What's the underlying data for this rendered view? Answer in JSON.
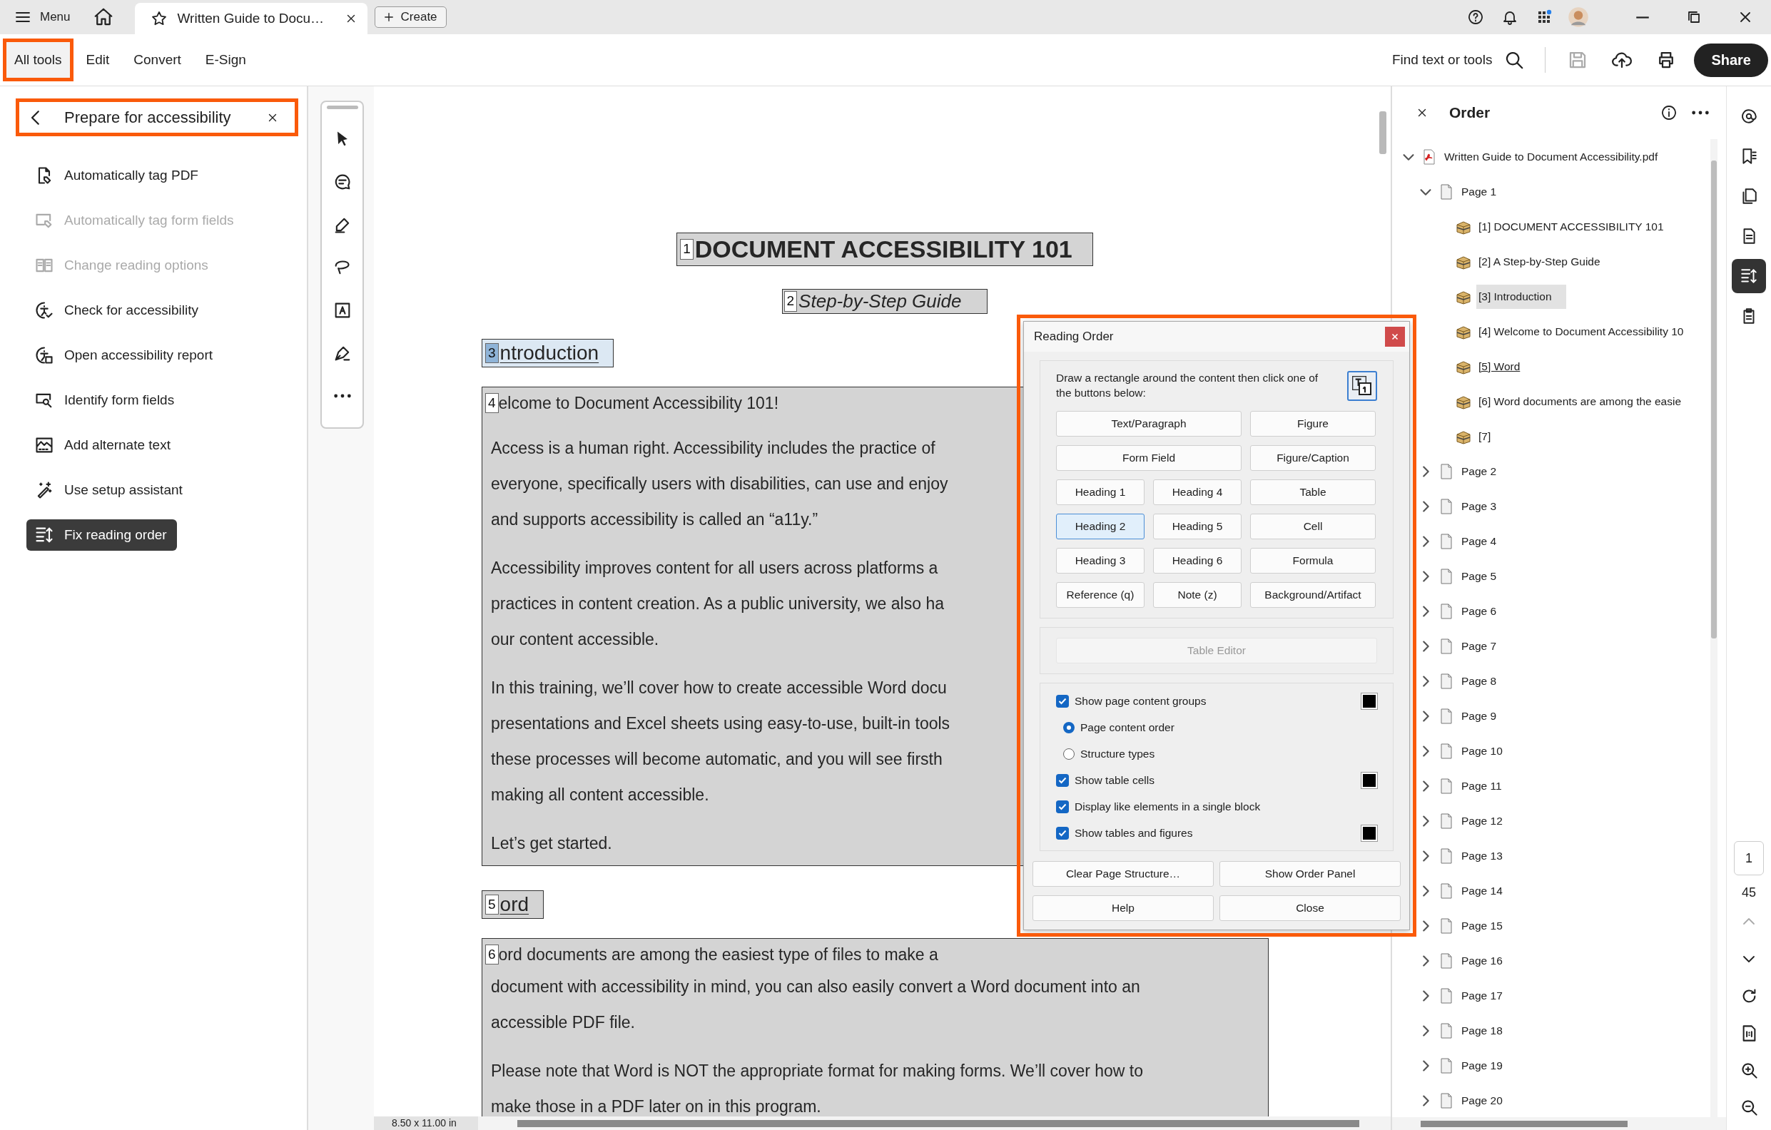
{
  "title_bar": {
    "menu": "Menu",
    "tab": {
      "title": "Written Guide to Docu…"
    },
    "create": "Create"
  },
  "toolbar": {
    "tabs": [
      {
        "label": "All tools",
        "selected": true,
        "highlighted": true
      },
      {
        "label": "Edit",
        "selected": false,
        "highlighted": false
      },
      {
        "label": "Convert",
        "selected": false,
        "highlighted": false
      },
      {
        "label": "E-Sign",
        "selected": false,
        "highlighted": false
      }
    ],
    "search": "Find text or tools",
    "share": "Share"
  },
  "left_panel": {
    "title": "Prepare for accessibility",
    "highlighted": true,
    "items": [
      {
        "label": "Automatically tag PDF",
        "disabled": false,
        "selected": false
      },
      {
        "label": "Automatically tag form fields",
        "disabled": true,
        "selected": false
      },
      {
        "label": "Change reading options",
        "disabled": true,
        "selected": false
      },
      {
        "label": "Check for accessibility",
        "disabled": false,
        "selected": false
      },
      {
        "label": "Open accessibility report",
        "disabled": false,
        "selected": false
      },
      {
        "label": "Identify form fields",
        "disabled": false,
        "selected": false
      },
      {
        "label": "Add alternate text",
        "disabled": false,
        "selected": false
      },
      {
        "label": "Use setup assistant",
        "disabled": false,
        "selected": false
      },
      {
        "label": "Fix reading order",
        "disabled": false,
        "selected": true
      }
    ]
  },
  "document": {
    "blocks": [
      {
        "kind": "title",
        "tag": "1",
        "text": "DOCUMENT ACCESSIBILITY 101",
        "selected": false
      },
      {
        "kind": "subtitle",
        "tag": "2",
        "text": "Step-by-Step Guide",
        "selected": false
      },
      {
        "kind": "heading",
        "tag": "3",
        "text": "ntroduction",
        "selected": true
      },
      {
        "kind": "body",
        "tag": "4",
        "selected": false,
        "paragraphs": [
          [
            "elcome to Document Accessibility 101!"
          ],
          [
            "Access is a human right. Accessibility includes the practice of",
            "everyone, specifically users with disabilities, can use and enjoy",
            "and supports accessibility is called an “a11y.”"
          ],
          [
            "Accessibility improves content for all users across platforms a",
            "practices in content creation. As a public university, we also ha",
            "our content accessible."
          ],
          [
            "In this training, we’ll cover how to create accessible Word docu",
            "presentations and Excel sheets using easy-to-use, built-in tools",
            "these processes will become automatic, and you will see firsth",
            "making all content accessible."
          ],
          [
            "Let’s get started."
          ]
        ]
      },
      {
        "kind": "heading",
        "tag": "5",
        "text": "ord",
        "selected": false
      },
      {
        "kind": "body",
        "tag": "6",
        "selected": false,
        "paragraphs": [
          [
            "ord documents are among the easiest type of files to make a",
            "document with accessibility in mind, you can also easily convert a Word document into an",
            "accessible PDF file."
          ],
          [
            "Please note that Word is NOT the appropriate format for making forms. We’ll cover how to",
            "make those in a PDF later on in this program."
          ]
        ]
      }
    ],
    "page_size": "8.50 x 11.00 in"
  },
  "reading_order_dialog": {
    "title": "Reading Order",
    "highlighted": true,
    "instructions": "Draw a rectangle around the content then click one of the buttons below:",
    "button_rows": [
      [
        {
          "label": "Text/Paragraph",
          "selected": false
        },
        {
          "label": "Figure",
          "selected": false
        }
      ],
      [
        {
          "label": "Form Field",
          "selected": false
        },
        {
          "label": "Figure/Caption",
          "selected": false
        }
      ],
      [
        {
          "label": "Heading 1",
          "selected": false
        },
        {
          "label": "Heading 4",
          "selected": false
        },
        {
          "label": "Table",
          "selected": false
        }
      ],
      [
        {
          "label": "Heading 2",
          "selected": true
        },
        {
          "label": "Heading 5",
          "selected": false
        },
        {
          "label": "Cell",
          "selected": false
        }
      ],
      [
        {
          "label": "Heading 3",
          "selected": false
        },
        {
          "label": "Heading 6",
          "selected": false
        },
        {
          "label": "Formula",
          "selected": false
        }
      ],
      [
        {
          "label": "Reference (q)",
          "selected": false
        },
        {
          "label": "Note (z)",
          "selected": false
        },
        {
          "label": "Background/Artifact",
          "selected": false
        }
      ]
    ],
    "table_editor": {
      "label": "Table Editor",
      "disabled": true
    },
    "options": [
      {
        "kind": "checkbox",
        "label": "Show page content groups",
        "checked": true,
        "color": "#000000"
      },
      {
        "kind": "radio",
        "label": "Page content order",
        "selected": true
      },
      {
        "kind": "radio",
        "label": "Structure types",
        "selected": false
      },
      {
        "kind": "checkbox",
        "label": "Show table cells",
        "checked": true,
        "color": "#000000"
      },
      {
        "kind": "checkbox",
        "label": "Display like elements in a single block",
        "checked": true
      },
      {
        "kind": "checkbox",
        "label": "Show tables and figures",
        "checked": true,
        "color": "#000000"
      }
    ],
    "buttons": [
      "Clear Page Structure…",
      "Show Order Panel",
      "Help",
      "Close"
    ]
  },
  "order_panel": {
    "title": "Order",
    "tree": [
      {
        "kind": "file",
        "label": "Written Guide to Document Accessibility.pdf",
        "expanded": true,
        "children": [
          {
            "kind": "page",
            "label": "Page 1",
            "expanded": true,
            "children": [
              {
                "kind": "tag",
                "label": "[1]  DOCUMENT ACCESSIBILITY 101",
                "selected": false,
                "focused": false
              },
              {
                "kind": "tag",
                "label": "[2]  A Step-by-Step Guide",
                "selected": false,
                "focused": false
              },
              {
                "kind": "tag",
                "label": "[3]  Introduction",
                "selected": true,
                "focused": false
              },
              {
                "kind": "tag",
                "label": "[4]  Welcome to Document Accessibility 10",
                "selected": false,
                "focused": false
              },
              {
                "kind": "tag",
                "label": "[5]  Word",
                "selected": false,
                "focused": true
              },
              {
                "kind": "tag",
                "label": "[6]  Word documents are among the easie",
                "selected": false,
                "focused": false
              },
              {
                "kind": "tag",
                "label": "[7]",
                "selected": false,
                "focused": false
              }
            ]
          },
          {
            "kind": "page",
            "label": "Page 2",
            "expanded": false
          },
          {
            "kind": "page",
            "label": "Page 3",
            "expanded": false
          },
          {
            "kind": "page",
            "label": "Page 4",
            "expanded": false
          },
          {
            "kind": "page",
            "label": "Page 5",
            "expanded": false
          },
          {
            "kind": "page",
            "label": "Page 6",
            "expanded": false
          },
          {
            "kind": "page",
            "label": "Page 7",
            "expanded": false
          },
          {
            "kind": "page",
            "label": "Page 8",
            "expanded": false
          },
          {
            "kind": "page",
            "label": "Page 9",
            "expanded": false
          },
          {
            "kind": "page",
            "label": "Page 10",
            "expanded": false
          },
          {
            "kind": "page",
            "label": "Page 11",
            "expanded": false
          },
          {
            "kind": "page",
            "label": "Page 12",
            "expanded": false
          },
          {
            "kind": "page",
            "label": "Page 13",
            "expanded": false
          },
          {
            "kind": "page",
            "label": "Page 14",
            "expanded": false
          },
          {
            "kind": "page",
            "label": "Page 15",
            "expanded": false
          },
          {
            "kind": "page",
            "label": "Page 16",
            "expanded": false
          },
          {
            "kind": "page",
            "label": "Page 17",
            "expanded": false
          },
          {
            "kind": "page",
            "label": "Page 18",
            "expanded": false
          },
          {
            "kind": "page",
            "label": "Page 19",
            "expanded": false
          },
          {
            "kind": "page",
            "label": "Page 20",
            "expanded": false
          }
        ]
      }
    ]
  },
  "right_rail": {
    "page_number": "1",
    "page_count": "45"
  }
}
